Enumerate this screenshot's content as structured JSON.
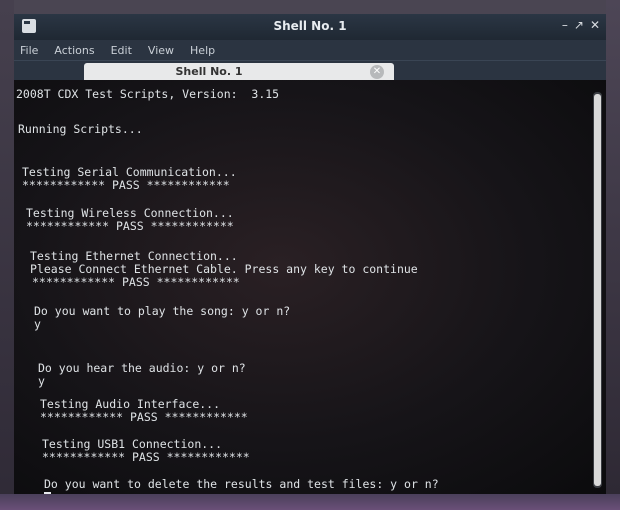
{
  "window": {
    "title": "Shell No. 1",
    "controls": {
      "minimize": "–",
      "restore": "↗",
      "close": "✕"
    }
  },
  "menu": [
    "File",
    "Actions",
    "Edit",
    "View",
    "Help"
  ],
  "tab": {
    "label": "Shell No. 1",
    "close_glyph": "✕"
  },
  "terminal_lines": [
    "2008T CDX Test Scripts, Version:  3.15",
    "Running Scripts...",
    "Testing Serial Communication...",
    "************ PASS ************",
    "Testing Wireless Connection...",
    "************ PASS ************",
    "Testing Ethernet Connection...",
    "Please Connect Ethernet Cable. Press any key to continue",
    "************ PASS ************",
    "Do you want to play the song: y or n?",
    "y",
    "Do you hear the audio: y or n?",
    "y",
    "Testing Audio Interface...",
    "************ PASS ************",
    "Testing USB1 Connection...",
    "************ PASS ************",
    "Do you want to delete the results and test files: y or n?"
  ],
  "colors": {
    "titlebar": "#1f2833",
    "terminal_text": "#dfe3e6",
    "terminal_bg": "#161418"
  }
}
